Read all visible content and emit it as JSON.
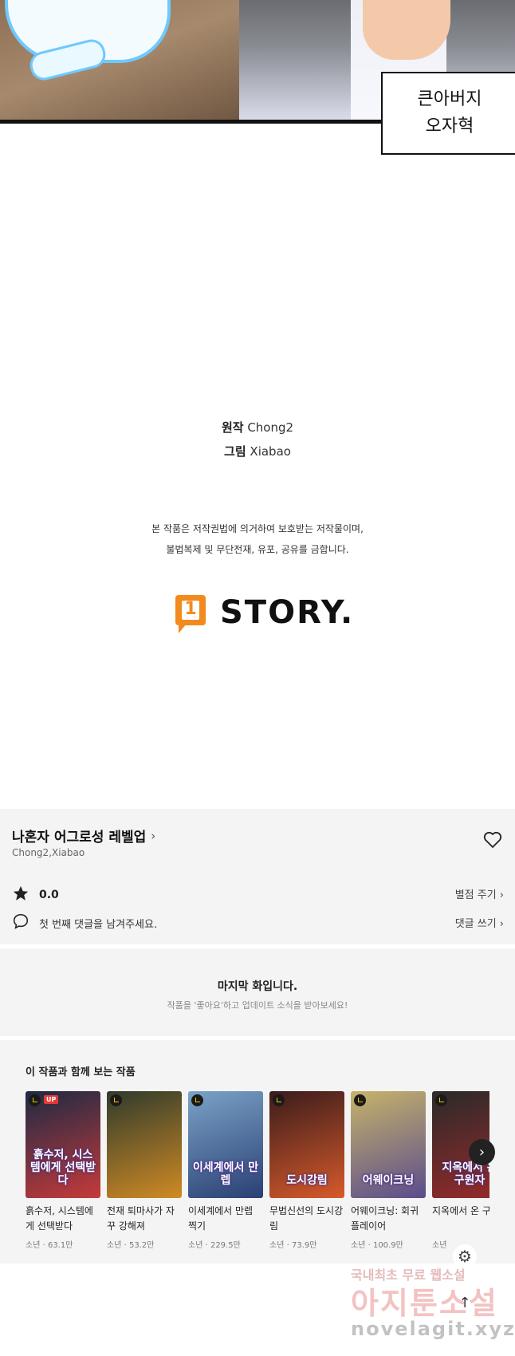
{
  "comic": {
    "caption_lines": [
      "큰아버지",
      "오자혁"
    ]
  },
  "credits": {
    "original_label": "원작",
    "original_value": "Chong2",
    "art_label": "그림",
    "art_value": "Xiabao",
    "notice_line1": "본 작품은 저작권법에 의거하여 보호받는 저작물이며,",
    "notice_line2": "불법복제 및 무단전재, 유포, 공유를 금합니다.",
    "logo_badge": "1",
    "logo_text": "STORY."
  },
  "series": {
    "title": "나혼자 어그로성 레벨업",
    "chevron": "›",
    "authors": "Chong2,Xiabao",
    "rating": "0.0",
    "rate_link": "별점 주기 ›",
    "comment_prompt": "첫 번째 댓글을 남겨주세요.",
    "comment_link": "댓글 쓰기 ›"
  },
  "last_episode": {
    "heading": "마지막 화입니다.",
    "sub": "작품을 '좋아요'하고 업데이트 소식을 받아보세요!"
  },
  "recommendations": {
    "title": "이 작품과 함께 보는 작품",
    "items": [
      {
        "title": "흙수저, 시스템에게 선택받다",
        "genre": "소년",
        "views": "63.1만",
        "badge": "UP",
        "cover_text": "흙수저, 시스템에게 선택받다",
        "colors": [
          "#1d2a44",
          "#c63a3a"
        ]
      },
      {
        "title": "전재 퇴마사가 자꾸 강해져",
        "genre": "소년",
        "views": "53.2만",
        "badge": "",
        "cover_text": "",
        "colors": [
          "#2f3b2c",
          "#d08a24"
        ]
      },
      {
        "title": "이세계에서 만렙 찍기",
        "genre": "소년",
        "views": "229.5만",
        "badge": "",
        "cover_text": "이세계에서 만렙",
        "colors": [
          "#7aa3c7",
          "#2a3f73"
        ]
      },
      {
        "title": "무법신선의 도시강림",
        "genre": "소년",
        "views": "73.9만",
        "badge": "",
        "cover_text": "도시강림",
        "colors": [
          "#3a1c1c",
          "#d65a2a"
        ]
      },
      {
        "title": "어웨이크닝: 회귀 플레이어",
        "genre": "소년",
        "views": "100.9만",
        "badge": "",
        "cover_text": "어웨이크닝",
        "colors": [
          "#c7b36a",
          "#5a4c8c"
        ]
      },
      {
        "title": "지옥에서 온 구자",
        "genre": "소년",
        "views": "",
        "badge": "",
        "cover_text": "지옥에서 온 구원자",
        "colors": [
          "#2a2a2a",
          "#9a2a2a"
        ]
      }
    ],
    "separator": " · "
  },
  "watermark": {
    "line1": "국내최초 무료 웹소설",
    "line2": "아지툰소설",
    "line3": "novelagit.xyz"
  }
}
